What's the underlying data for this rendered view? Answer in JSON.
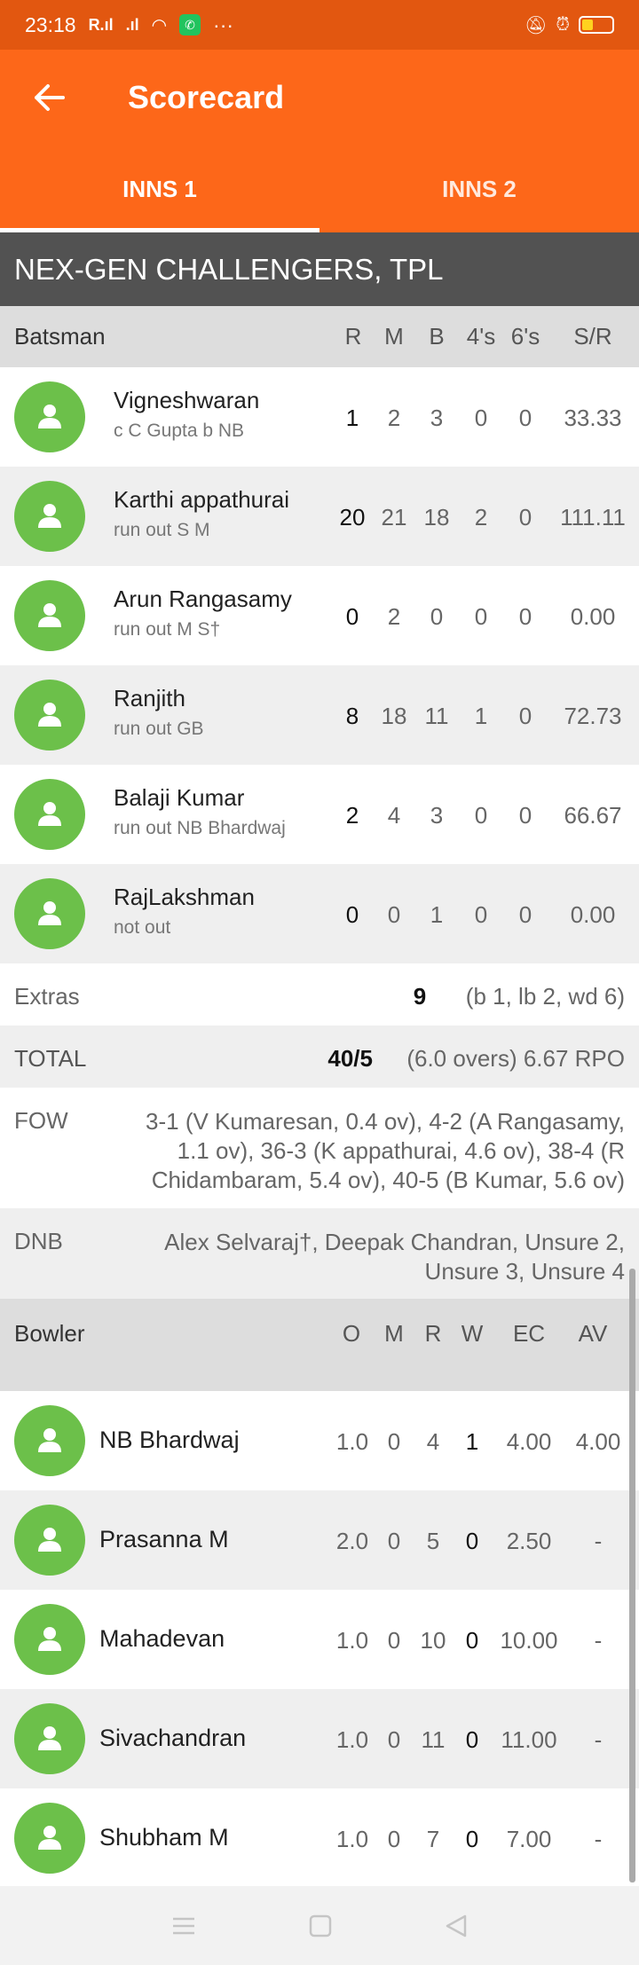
{
  "status_bar": {
    "time": "23:18",
    "signal1": "R.ıl",
    "signal2": ".ıl",
    "dots": "···"
  },
  "app_bar": {
    "title": "Scorecard"
  },
  "tabs": [
    {
      "label": "INNS 1"
    },
    {
      "label": "INNS 2"
    }
  ],
  "team": "NEX-GEN CHALLENGERS, TPL",
  "batting": {
    "header": {
      "name": "Batsman",
      "r": "R",
      "m": "M",
      "b": "B",
      "fours": "4's",
      "sixes": "6's",
      "sr": "S/R"
    },
    "rows": [
      {
        "name": "Vigneshwaran",
        "dismissal": "c C Gupta b NB",
        "r": "1",
        "m": "2",
        "b": "3",
        "fours": "0",
        "sixes": "0",
        "sr": "33.33"
      },
      {
        "name": "Karthi appathurai",
        "dismissal": "run out S M",
        "r": "20",
        "m": "21",
        "b": "18",
        "fours": "2",
        "sixes": "0",
        "sr": "111.11"
      },
      {
        "name": "Arun Rangasamy",
        "dismissal": "run out M S†",
        "r": "0",
        "m": "2",
        "b": "0",
        "fours": "0",
        "sixes": "0",
        "sr": "0.00"
      },
      {
        "name": "Ranjith",
        "dismissal": "run out GB",
        "r": "8",
        "m": "18",
        "b": "11",
        "fours": "1",
        "sixes": "0",
        "sr": "72.73"
      },
      {
        "name": "Balaji Kumar",
        "dismissal": "run out NB Bhardwaj",
        "r": "2",
        "m": "4",
        "b": "3",
        "fours": "0",
        "sixes": "0",
        "sr": "66.67"
      },
      {
        "name": "RajLakshman",
        "dismissal": "not out",
        "r": "0",
        "m": "0",
        "b": "1",
        "fours": "0",
        "sixes": "0",
        "sr": "0.00"
      }
    ]
  },
  "extras": {
    "label": "Extras",
    "value": "9",
    "detail": "(b 1, lb 2, wd 6)"
  },
  "total": {
    "label": "TOTAL",
    "value": "40/5",
    "detail": "(6.0 overs) 6.67 RPO"
  },
  "fow": {
    "label": "FOW",
    "line1": "3-1 (V Kumaresan, 0.4 ov), 4-2 (A Rangasamy,",
    "line2": "1.1 ov), 36-3 (K appathurai, 4.6 ov), 38-4 (R",
    "line3": "Chidambaram, 5.4 ov), 40-5 (B Kumar, 5.6 ov)"
  },
  "dnb": {
    "label": "DNB",
    "line1": "Alex Selvaraj†, Deepak Chandran, Unsure 2,",
    "line2": "Unsure 3, Unsure 4"
  },
  "bowling": {
    "header": {
      "name": "Bowler",
      "o": "O",
      "m": "M",
      "r": "R",
      "w": "W",
      "ec": "EC",
      "av": "AV"
    },
    "rows": [
      {
        "name": "NB Bhardwaj",
        "o": "1.0",
        "m": "0",
        "r": "4",
        "w": "1",
        "ec": "4.00",
        "av": "4.00"
      },
      {
        "name": "Prasanna M",
        "o": "2.0",
        "m": "0",
        "r": "5",
        "w": "0",
        "ec": "2.50",
        "av": "-"
      },
      {
        "name": "Mahadevan",
        "o": "1.0",
        "m": "0",
        "r": "10",
        "w": "0",
        "ec": "10.00",
        "av": "-"
      },
      {
        "name": "Sivachandran",
        "o": "1.0",
        "m": "0",
        "r": "11",
        "w": "0",
        "ec": "11.00",
        "av": "-"
      },
      {
        "name": "Shubham M",
        "o": "1.0",
        "m": "0",
        "r": "7",
        "w": "0",
        "ec": "7.00",
        "av": "-"
      }
    ]
  },
  "colors": {
    "primary": "#fd6719",
    "status": "#e25710",
    "team_header": "#525252",
    "avatar": "#6cc04a"
  },
  "icons": {
    "back": "arrow-left-icon",
    "avatar": "person-icon",
    "nav_menu": "menu-icon",
    "nav_home": "home-square-icon",
    "nav_back": "back-triangle-icon"
  }
}
